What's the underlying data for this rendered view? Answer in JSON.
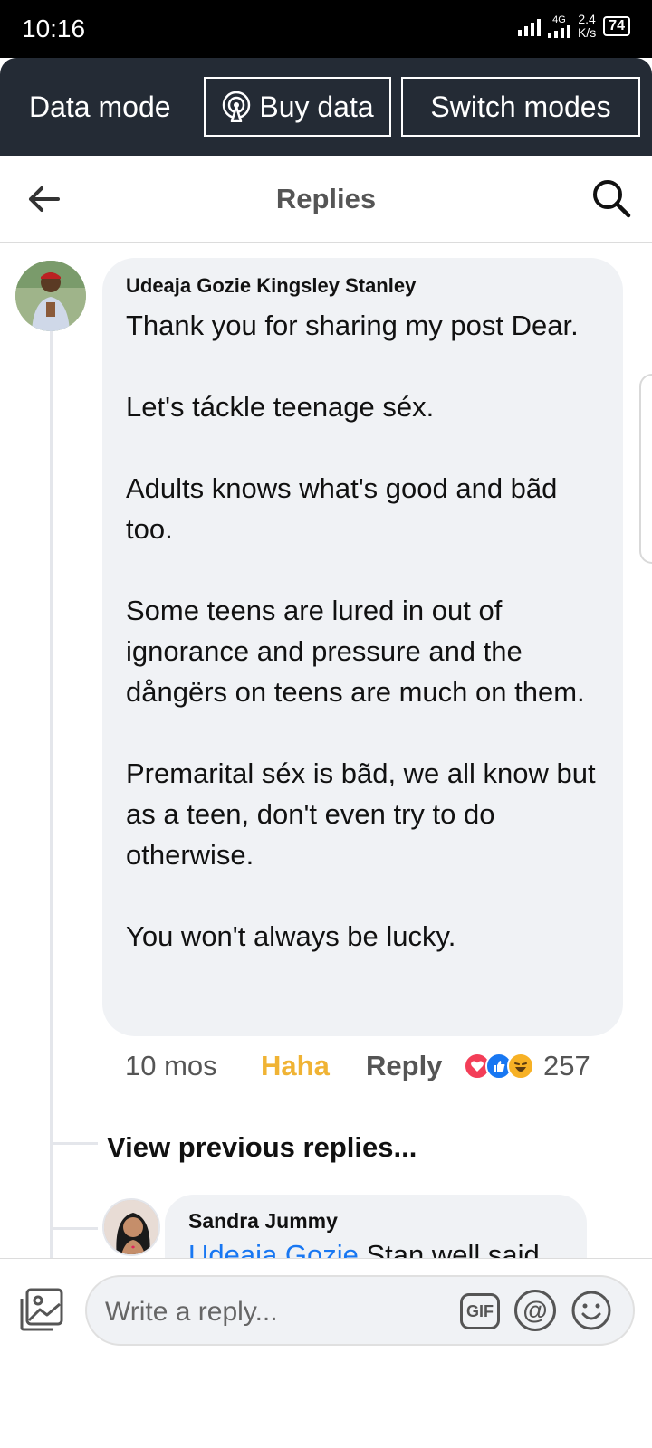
{
  "status_bar": {
    "time": "10:16",
    "network": "4G",
    "speed_value": "2.4",
    "speed_unit": "K/s",
    "battery": "74"
  },
  "data_bar": {
    "mode_label": "Data mode",
    "buy_label": "Buy data",
    "switch_label": "Switch modes"
  },
  "header": {
    "title": "Replies"
  },
  "comment": {
    "author": "Udeaja Gozie Kingsley Stanley",
    "text": "Thank you for sharing my post Dear.\n\nLet's táckle teenage séx.\n\nAdults knows what's good and bãd too.\n\nSome teens are lured in out of ignorance and pressure and the dångërs on teens are much on them.\n\nPremarital séx is bãd, we all know but as a teen, don't even try to do otherwise.\n\nYou won't always be lucky.",
    "time": "10 mos",
    "reaction_label": "Haha",
    "reply_label": "Reply",
    "reaction_count": "257",
    "reactions": [
      "heart-icon",
      "like-icon",
      "haha-icon"
    ],
    "colors": {
      "love": "#f33e58",
      "like": "#1877f2",
      "haha": "#f7b125"
    }
  },
  "view_previous": "View previous replies...",
  "reply": {
    "author": "Sandra Jummy",
    "mention": "Udeaja Gozie",
    "text": "Stan well said"
  },
  "composer": {
    "placeholder": "Write a reply...",
    "gif_label": "GIF",
    "at_label": "@"
  }
}
